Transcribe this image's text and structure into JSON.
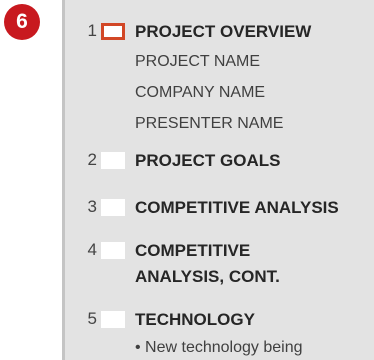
{
  "step_badge": "6",
  "outline": {
    "slides": [
      {
        "number": "1",
        "title": "PROJECT OVERVIEW",
        "selected": true,
        "lines": [
          "PROJECT NAME",
          "COMPANY NAME",
          "PRESENTER NAME"
        ]
      },
      {
        "number": "2",
        "title": "PROJECT GOALS",
        "selected": false,
        "lines": []
      },
      {
        "number": "3",
        "title": "COMPETITIVE ANALYSIS",
        "selected": false,
        "lines": []
      },
      {
        "number": "4",
        "title_line1": "COMPETITIVE",
        "title_line2": "ANALYSIS, CONT.",
        "selected": false,
        "lines": []
      },
      {
        "number": "5",
        "title": "TECHNOLOGY",
        "selected": false,
        "lines": [
          "• New technology being"
        ]
      }
    ]
  },
  "colors": {
    "badge": "#c8191f",
    "selected_border": "#d24726",
    "pane_background": "#e3e3e3"
  }
}
